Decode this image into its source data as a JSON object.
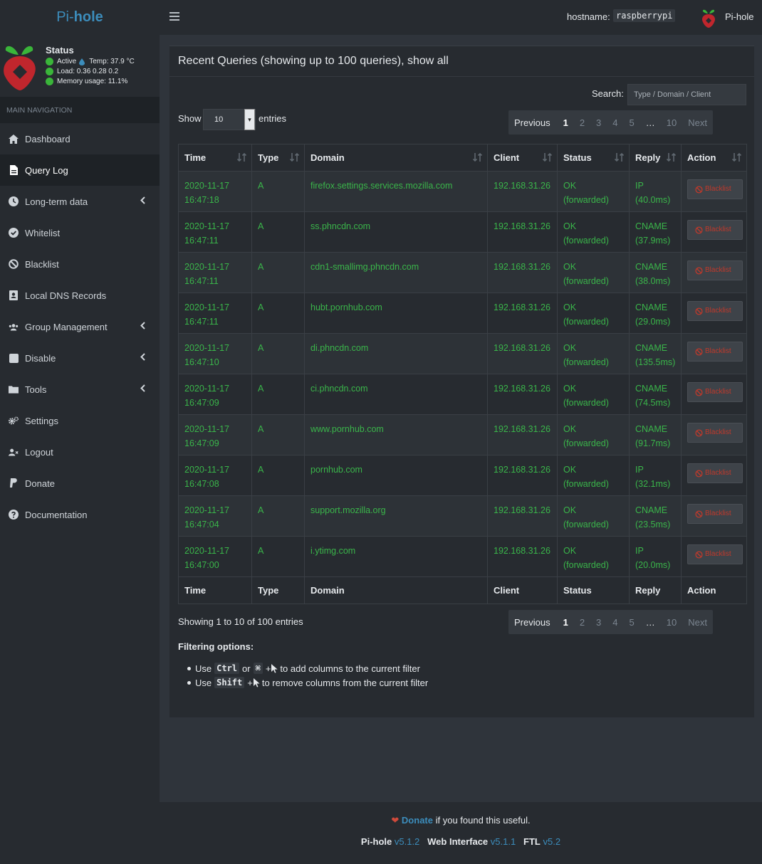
{
  "brand": {
    "pre": "Pi-",
    "post": "hole"
  },
  "status": {
    "title": "Status",
    "active": "Active",
    "temp": "Temp: 37.9 °C",
    "load": "Load:  0.36  0.28  0.2",
    "memory": "Memory usage:  11.1%"
  },
  "nav": {
    "header": "MAIN NAVIGATION",
    "items": [
      {
        "label": "Dashboard",
        "icon": "home-icon"
      },
      {
        "label": "Query Log",
        "icon": "file-icon"
      },
      {
        "label": "Long-term data",
        "icon": "clock-icon"
      },
      {
        "label": "Whitelist",
        "icon": "check-circle-icon"
      },
      {
        "label": "Blacklist",
        "icon": "ban-icon"
      },
      {
        "label": "Local DNS Records",
        "icon": "address-book-icon"
      },
      {
        "label": "Group Management",
        "icon": "users-icon"
      },
      {
        "label": "Disable",
        "icon": "stop-icon"
      },
      {
        "label": "Tools",
        "icon": "folder-icon"
      },
      {
        "label": "Settings",
        "icon": "cogs-icon"
      },
      {
        "label": "Logout",
        "icon": "user-times-icon"
      },
      {
        "label": "Donate",
        "icon": "paypal-icon"
      },
      {
        "label": "Documentation",
        "icon": "question-circle-icon"
      }
    ]
  },
  "topbar": {
    "hostname_label": "hostname:",
    "hostname": "raspberrypi",
    "name": "Pi-hole"
  },
  "box": {
    "title": "Recent Queries (showing up to 100 queries), show all"
  },
  "search": {
    "label": "Search:",
    "placeholder": "Type / Domain / Client"
  },
  "length": {
    "show": "Show",
    "value": "10",
    "entries": "entries"
  },
  "pager": {
    "previous": "Previous",
    "pages": [
      "1",
      "2",
      "3",
      "4",
      "5",
      "…",
      "10"
    ],
    "next": "Next"
  },
  "table": {
    "columns": [
      "Time",
      "Type",
      "Domain",
      "Client",
      "Status",
      "Reply",
      "Action"
    ],
    "button_label": "Blacklist",
    "rows": [
      {
        "date": "2020-11-17",
        "time": "16:47:18",
        "type": "A",
        "domain": "firefox.settings.services.mozilla.com",
        "client": "192.168.31.26",
        "status": "OK",
        "status2": "(forwarded)",
        "reply": "IP",
        "reply2": "(40.0ms)"
      },
      {
        "date": "2020-11-17",
        "time": "16:47:11",
        "type": "A",
        "domain": "ss.phncdn.com",
        "client": "192.168.31.26",
        "status": "OK",
        "status2": "(forwarded)",
        "reply": "CNAME",
        "reply2": "(37.9ms)"
      },
      {
        "date": "2020-11-17",
        "time": "16:47:11",
        "type": "A",
        "domain": "cdn1-smallimg.phncdn.com",
        "client": "192.168.31.26",
        "status": "OK",
        "status2": "(forwarded)",
        "reply": "CNAME",
        "reply2": "(38.0ms)"
      },
      {
        "date": "2020-11-17",
        "time": "16:47:11",
        "type": "A",
        "domain": "hubt.pornhub.com",
        "client": "192.168.31.26",
        "status": "OK",
        "status2": "(forwarded)",
        "reply": "CNAME",
        "reply2": "(29.0ms)"
      },
      {
        "date": "2020-11-17",
        "time": "16:47:10",
        "type": "A",
        "domain": "di.phncdn.com",
        "client": "192.168.31.26",
        "status": "OK",
        "status2": "(forwarded)",
        "reply": "CNAME",
        "reply2": "(135.5ms)"
      },
      {
        "date": "2020-11-17",
        "time": "16:47:09",
        "type": "A",
        "domain": "ci.phncdn.com",
        "client": "192.168.31.26",
        "status": "OK",
        "status2": "(forwarded)",
        "reply": "CNAME",
        "reply2": "(74.5ms)"
      },
      {
        "date": "2020-11-17",
        "time": "16:47:09",
        "type": "A",
        "domain": "www.pornhub.com",
        "client": "192.168.31.26",
        "status": "OK",
        "status2": "(forwarded)",
        "reply": "CNAME",
        "reply2": "(91.7ms)"
      },
      {
        "date": "2020-11-17",
        "time": "16:47:08",
        "type": "A",
        "domain": "pornhub.com",
        "client": "192.168.31.26",
        "status": "OK",
        "status2": "(forwarded)",
        "reply": "IP",
        "reply2": "(32.1ms)"
      },
      {
        "date": "2020-11-17",
        "time": "16:47:04",
        "type": "A",
        "domain": "support.mozilla.org",
        "client": "192.168.31.26",
        "status": "OK",
        "status2": "(forwarded)",
        "reply": "CNAME",
        "reply2": "(23.5ms)"
      },
      {
        "date": "2020-11-17",
        "time": "16:47:00",
        "type": "A",
        "domain": "i.ytimg.com",
        "client": "192.168.31.26",
        "status": "OK",
        "status2": "(forwarded)",
        "reply": "IP",
        "reply2": "(20.0ms)"
      }
    ]
  },
  "showing": "Showing 1 to 10 of 100 entries",
  "filtering": {
    "title": "Filtering options:",
    "line1": {
      "use": "Use",
      "key1": "Ctrl",
      "or": "or",
      "key2": "⌘",
      "plus": "+",
      "text": "to add columns to the current filter"
    },
    "line2": {
      "use": "Use",
      "key1": "Shift",
      "plus": "+",
      "text": "to remove columns from the current filter"
    }
  },
  "footer": {
    "donate": "Donate",
    "donate_text": "if you found this useful.",
    "pihole": "Pi-hole",
    "pihole_ver": "v5.1.2",
    "web": "Web Interface",
    "web_ver": "v5.1.1",
    "ftl": "FTL",
    "ftl_ver": "v5.2"
  },
  "colors": {
    "accent": "#3c8dbc",
    "green": "#3ab54a",
    "red": "#c0392b"
  }
}
